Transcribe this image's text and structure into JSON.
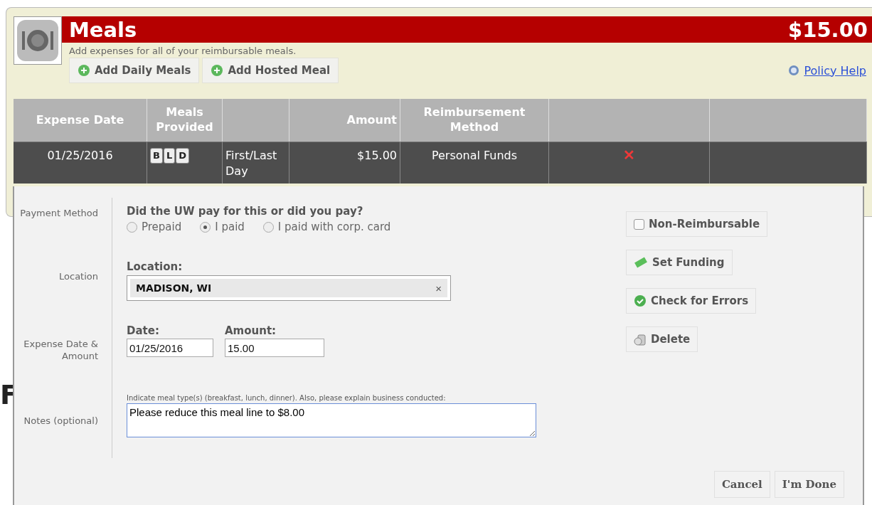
{
  "section": {
    "title": "Meals",
    "total": "$15.00",
    "subtitle": "Add expenses for all of your reimbursable meals.",
    "actions": [
      "Add Daily Meals",
      "Add Hosted Meal"
    ],
    "help_link": "Policy Help"
  },
  "table": {
    "columns": [
      "Expense Date",
      "Meals Provided",
      "",
      "Amount",
      "Reimbursement Method",
      "",
      ""
    ],
    "rows": [
      {
        "date": "01/25/2016",
        "meals": [
          "B",
          "L",
          "D"
        ],
        "day": "First/Last Day",
        "amount": "$15.00",
        "method": "Personal Funds",
        "delete": "✕"
      }
    ]
  },
  "background_heading": "F",
  "editor": {
    "sections": [
      {
        "kind": "payment",
        "label": "Payment Method",
        "question": "Did the UW pay for this or did you pay?",
        "options": [
          {
            "label": "Prepaid",
            "selected": false
          },
          {
            "label": "I paid",
            "selected": true
          },
          {
            "label": "I paid with corp. card",
            "selected": false
          }
        ]
      },
      {
        "kind": "location",
        "label": "Location",
        "field_label": "Location:",
        "value": "MADISON, WI",
        "clear": "×"
      },
      {
        "kind": "date_amount",
        "label": "Expense Date & Amount",
        "date_label": "Date:",
        "date": "01/25/2016",
        "amount_label": "Amount:",
        "amount": "15.00"
      },
      {
        "kind": "notes",
        "label": "Notes (optional)",
        "hint": "Indicate meal type(s) (breakfast, lunch, dinner). Also, please explain business conducted:",
        "value": "Please reduce this meal line to $8.00"
      }
    ],
    "side_buttons": [
      {
        "kind": "checkbox",
        "label": "Non-Reimbursable",
        "checked": false
      },
      {
        "kind": "funding",
        "label": "Set Funding"
      },
      {
        "kind": "check",
        "label": "Check for Errors"
      },
      {
        "kind": "delete",
        "label": "Delete"
      }
    ],
    "footer_buttons": [
      "Cancel",
      "I'm Done"
    ]
  }
}
